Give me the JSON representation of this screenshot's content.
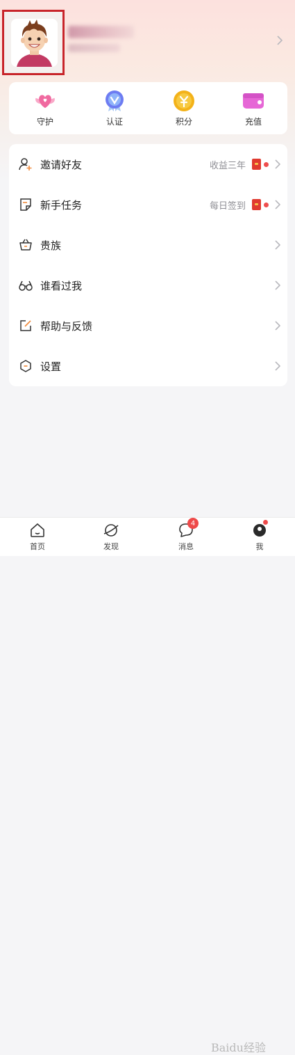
{
  "profile": {
    "avatar_icon": "cartoon-boy-avatar",
    "chevron_icon": "chevron-right-icon"
  },
  "quick_actions": [
    {
      "label": "守护",
      "icon": "heart-wings-icon",
      "color": "#f06aa0"
    },
    {
      "label": "认证",
      "icon": "verified-badge-icon",
      "color": "#6d7cf2"
    },
    {
      "label": "积分",
      "icon": "coin-icon",
      "color": "#f3b219"
    },
    {
      "label": "充值",
      "icon": "wallet-icon",
      "color": "#e667d6"
    }
  ],
  "menu": [
    {
      "label": "邀请好友",
      "hint": "收益三年",
      "icon": "add-user-icon",
      "red_packet": true,
      "dot": true
    },
    {
      "label": "新手任务",
      "hint": "每日签到",
      "icon": "task-note-icon",
      "red_packet": true,
      "dot": true
    },
    {
      "label": "贵族",
      "hint": "",
      "icon": "basket-icon",
      "red_packet": false,
      "dot": false
    },
    {
      "label": "谁看过我",
      "hint": "",
      "icon": "glasses-icon",
      "red_packet": false,
      "dot": false
    },
    {
      "label": "帮助与反馈",
      "hint": "",
      "icon": "edit-icon",
      "red_packet": false,
      "dot": false
    },
    {
      "label": "设置",
      "hint": "",
      "icon": "settings-hexagon-icon",
      "red_packet": false,
      "dot": false
    }
  ],
  "tabbar": {
    "tabs": [
      {
        "label": "首页",
        "icon": "home-icon"
      },
      {
        "label": "发现",
        "icon": "planet-icon"
      },
      {
        "label": "消息",
        "icon": "chat-bubble-icon",
        "badge": "4"
      },
      {
        "label": "我",
        "icon": "profile-icon",
        "dot": true
      }
    ]
  },
  "watermark": "Baidu经验",
  "colors": {
    "accent_red": "#ee4a4a",
    "highlight_box": "#c8252b"
  }
}
